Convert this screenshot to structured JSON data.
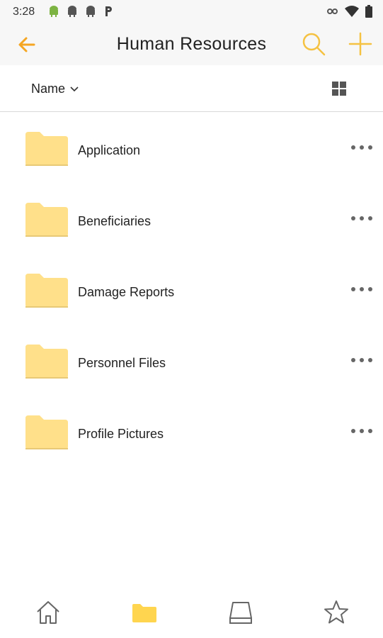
{
  "status_bar": {
    "time": "3:28",
    "left_icons": [
      "android-icon",
      "android-icon",
      "android-icon",
      "p-icon"
    ],
    "right_icons": [
      "vpn-key-icon",
      "wifi-icon",
      "battery-icon"
    ]
  },
  "app_bar": {
    "title": "Human Resources",
    "back_icon": "arrow-left-icon",
    "search_icon": "search-icon",
    "add_icon": "plus-icon",
    "accent_color": "#F5A623"
  },
  "sort_bar": {
    "sort_label": "Name",
    "sort_icon": "chevron-down-icon",
    "view_toggle_icon": "grid-view-icon"
  },
  "folders": [
    {
      "name": "Application"
    },
    {
      "name": "Beneficiaries"
    },
    {
      "name": "Damage Reports"
    },
    {
      "name": "Personnel Files"
    },
    {
      "name": "Profile Pictures"
    }
  ],
  "folder_color": "#FFE08A",
  "bottom_nav": {
    "items": [
      {
        "icon": "home-icon",
        "active": false
      },
      {
        "icon": "folder-icon",
        "active": true
      },
      {
        "icon": "drive-icon",
        "active": false
      },
      {
        "icon": "star-icon",
        "active": false
      }
    ],
    "active_color": "#FFD54F"
  }
}
